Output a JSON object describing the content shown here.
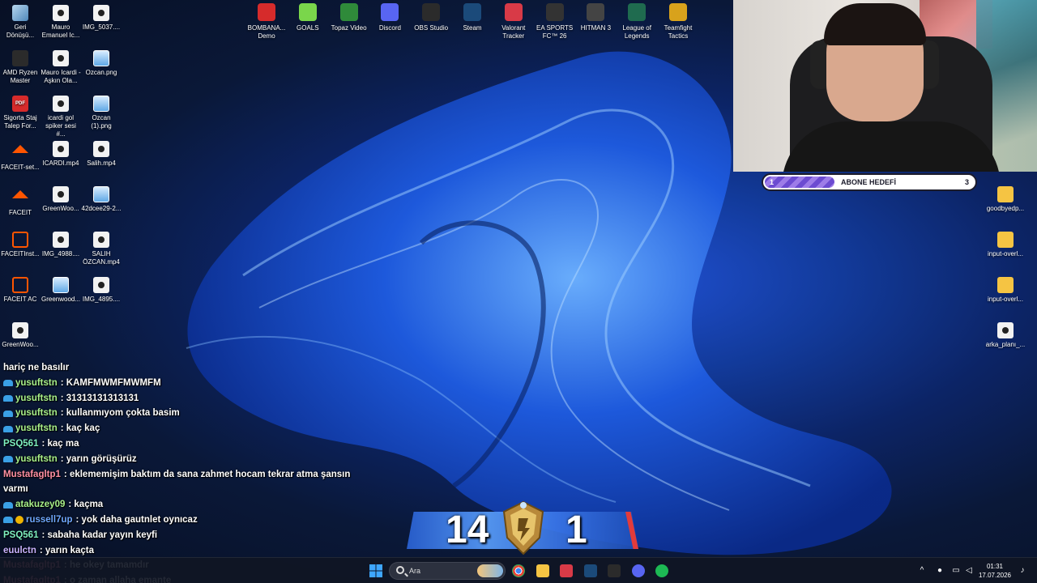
{
  "desktop_icons": [
    {
      "label": "Geri Dönüşü...",
      "icon": "recycle-bin-icon"
    },
    {
      "label": "Mauro Emanuel Ic...",
      "icon": "video-file-icon"
    },
    {
      "label": "IMG_5037....",
      "icon": "video-file-icon"
    },
    {
      "label": "AMD Ryzen Master",
      "icon": "amd-icon"
    },
    {
      "label": "Mauro Icardi - Aşkın Ola...",
      "icon": "video-file-icon"
    },
    {
      "label": "Ozcan.png",
      "icon": "image-file-icon"
    },
    {
      "label": "Sigorta Staj Talep For...",
      "icon": "pdf-file-icon"
    },
    {
      "label": "icardi gol spiker sesi #...",
      "icon": "video-file-icon"
    },
    {
      "label": "Ozcan (1).png",
      "icon": "image-file-icon"
    },
    {
      "label": "FACEIT-set...",
      "icon": "faceit-icon"
    },
    {
      "label": "ICARDI.mp4",
      "icon": "video-file-icon"
    },
    {
      "label": "Salih.mp4",
      "icon": "video-file-icon"
    },
    {
      "label": "FACEIT",
      "icon": "faceit-icon"
    },
    {
      "label": "GreenWoo...",
      "icon": "video-file-icon"
    },
    {
      "label": "42dcee29-2...",
      "icon": "image-file-icon"
    },
    {
      "label": "FACEITInst...",
      "icon": "shield-icon"
    },
    {
      "label": "IMG_4988....",
      "icon": "video-file-icon"
    },
    {
      "label": "SALIH ÖZCAN.mp4",
      "icon": "video-file-icon"
    },
    {
      "label": "FACEIT AC",
      "icon": "shield-icon"
    },
    {
      "label": "Greenwood...",
      "icon": "image-file-icon"
    },
    {
      "label": "IMG_4895....",
      "icon": "video-file-icon"
    },
    {
      "label": "GreenWoo...",
      "icon": "video-file-icon"
    }
  ],
  "right_icons": [
    {
      "label": "goodbyedp...",
      "icon": "folder-icon"
    },
    {
      "label": "input-overl...",
      "icon": "folder-icon"
    },
    {
      "label": "input-overl...",
      "icon": "folder-icon"
    },
    {
      "label": "arka_planı_...",
      "icon": "video-file-icon"
    }
  ],
  "apps": [
    {
      "label": "BOMBANA... Demo",
      "icon": "car-icon",
      "color": "#d62b2b"
    },
    {
      "label": "GOALS",
      "icon": "goals-icon",
      "color": "#7ad64b"
    },
    {
      "label": "Topaz Video",
      "icon": "topaz-icon",
      "color": "#2f8a3a"
    },
    {
      "label": "Discord",
      "icon": "discord-icon",
      "color": "#5865f2"
    },
    {
      "label": "OBS Studio",
      "icon": "obs-icon",
      "color": "#2b2b2b"
    },
    {
      "label": "Steam",
      "icon": "steam-icon",
      "color": "#1b4a7a"
    },
    {
      "label": "Valorant Tracker",
      "icon": "valorant-icon",
      "color": "#d83a47"
    },
    {
      "label": "EA SPORTS FC™ 26",
      "icon": "ea-fc-icon",
      "color": "#333"
    },
    {
      "label": "HITMAN 3",
      "icon": "hitman-icon",
      "color": "#444"
    },
    {
      "label": "League of Legends",
      "icon": "lol-icon",
      "color": "#1f6b4f"
    },
    {
      "label": "Teamfight Tactics",
      "icon": "tft-icon",
      "color": "#d8a21c"
    }
  ],
  "goal": {
    "current": "1",
    "title": "ABONE HEDEFİ",
    "target": "3",
    "progress": 0.333
  },
  "chat": [
    {
      "user": "",
      "message": "hariç ne basılır",
      "color": "#ffffff",
      "badge": "none"
    },
    {
      "user": "yusuftstn",
      "message": ": KAMFMWMFMWMFM",
      "color": "#a8f08a",
      "badge": "sub"
    },
    {
      "user": "yusuftstn",
      "message": ": 31313131313131",
      "color": "#a8f08a",
      "badge": "sub"
    },
    {
      "user": "yusuftstn",
      "message": ": kullanmıyom çokta basim",
      "color": "#a8f08a",
      "badge": "sub"
    },
    {
      "user": "yusuftstn",
      "message": ": kaç kaç",
      "color": "#a8f08a",
      "badge": "sub"
    },
    {
      "user": "PSQ561",
      "message": ": kaç ma",
      "color": "#7ff0c0",
      "badge": "none"
    },
    {
      "user": "yusuftstn",
      "message": ": yarın görüşürüz",
      "color": "#a8f08a",
      "badge": "sub"
    },
    {
      "user": "Mustafagltp1",
      "message": ": eklememişim baktım da sana zahmet hocam tekrar atma şansın",
      "color": "#ff8fa3",
      "badge": "none"
    },
    {
      "user": "",
      "message": "varmı",
      "color": "#ffffff",
      "badge": "none"
    },
    {
      "user": "atakuzey09",
      "message": ": kaçma",
      "color": "#a8f08a",
      "badge": "sub"
    },
    {
      "user": "russell7up",
      "message": ": yok daha gautnlet oynıcaz",
      "color": "#6fa8ff",
      "badge": "both"
    },
    {
      "user": "PSQ561",
      "message": ": sabaha kadar yayın keyfi",
      "color": "#7ff0c0",
      "badge": "none"
    },
    {
      "user": "euulctn",
      "message": ": yarın kaçta",
      "color": "#c9b3ff",
      "badge": "none"
    },
    {
      "user": "Mustafagltp1",
      "message": ": he okey tamamdır",
      "color": "#ff8fa3",
      "badge": "none"
    },
    {
      "user": "Mustafagltp1",
      "message": ": o zaman allaha emante",
      "color": "#ff8fa3",
      "badge": "none"
    }
  ],
  "score": {
    "left": "14",
    "right": "1"
  },
  "taskbar": {
    "search_placeholder": "Ara",
    "time": "01:31",
    "date": "17.07.2026",
    "pinned": [
      "chrome-icon",
      "file-explorer-icon",
      "valorant-taskbar-icon",
      "steam-taskbar-icon",
      "obs-taskbar-icon",
      "discord-taskbar-icon",
      "spotify-icon"
    ]
  }
}
